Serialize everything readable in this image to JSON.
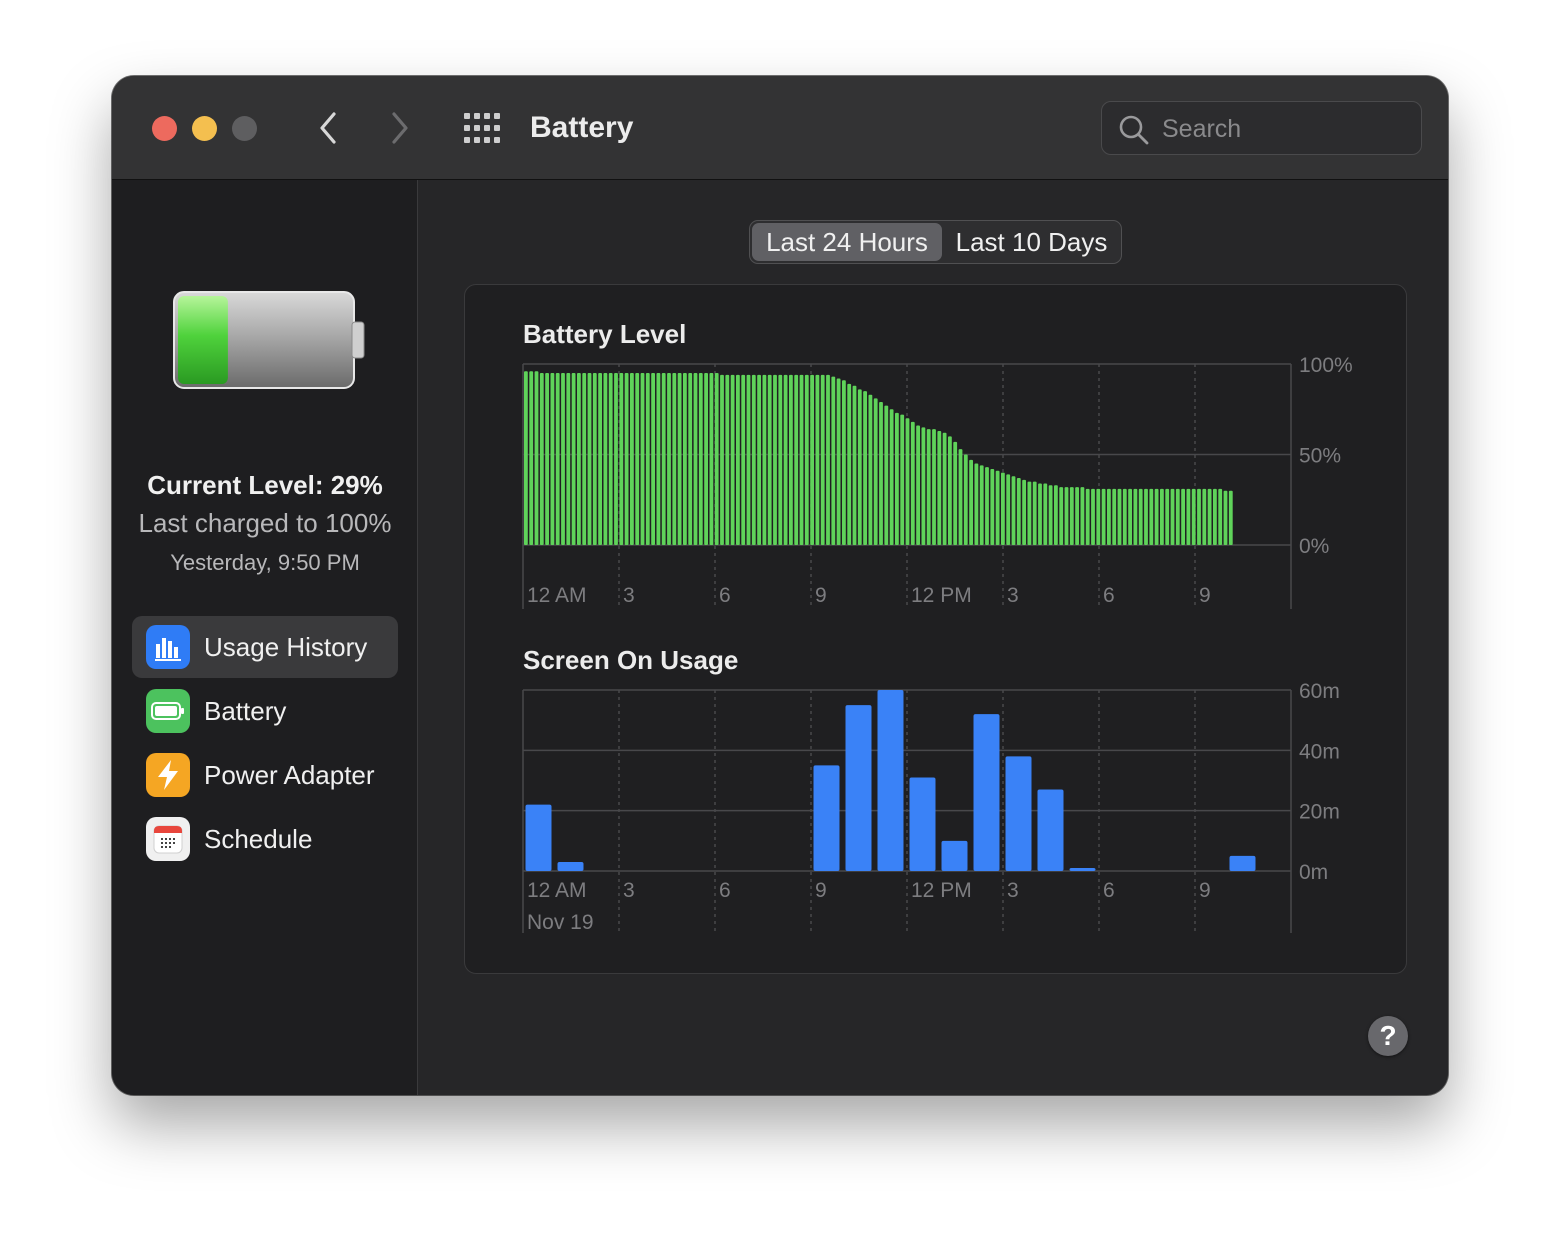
{
  "window": {
    "title": "Battery",
    "search_placeholder": "Search",
    "help_label": "?"
  },
  "sidebar": {
    "current_level": "Current Level: 29%",
    "last_charged": "Last charged to 100%",
    "last_charged_time": "Yesterday, 9:50 PM",
    "battery_icon_fill": 0.29,
    "items": [
      {
        "label": "Usage History",
        "icon": "usage-history-icon",
        "color": "#2f7cf6",
        "selected": true
      },
      {
        "label": "Battery",
        "icon": "battery-icon",
        "color": "#4cc25e",
        "selected": false
      },
      {
        "label": "Power Adapter",
        "icon": "power-adapter-icon",
        "color": "#f5a623",
        "selected": false
      },
      {
        "label": "Schedule",
        "icon": "schedule-icon",
        "color": "#f0f0f0",
        "selected": false
      }
    ]
  },
  "tabs": [
    {
      "label": "Last 24 Hours",
      "selected": true
    },
    {
      "label": "Last 10 Days",
      "selected": false
    }
  ],
  "chart_data": [
    {
      "type": "bar",
      "title": "Battery Level",
      "color": "#5fd35a",
      "x_ticks": [
        "12 AM",
        "3",
        "6",
        "9",
        "12 PM",
        "3",
        "6",
        "9"
      ],
      "y_ticks": [
        "100%",
        "50%",
        "0%"
      ],
      "ylim": [
        0,
        100
      ],
      "values": [
        96,
        96,
        96,
        95,
        95,
        95,
        95,
        95,
        95,
        95,
        95,
        95,
        95,
        95,
        95,
        95,
        95,
        95,
        95,
        95,
        95,
        95,
        95,
        95,
        95,
        95,
        95,
        95,
        95,
        95,
        95,
        95,
        95,
        95,
        95,
        95,
        95,
        94,
        94,
        94,
        94,
        94,
        94,
        94,
        94,
        94,
        94,
        94,
        94,
        94,
        94,
        94,
        94,
        94,
        94,
        94,
        94,
        94,
        93,
        92,
        91,
        89,
        88,
        86,
        85,
        83,
        81,
        79,
        77,
        75,
        73,
        72,
        70,
        68,
        66,
        65,
        64,
        64,
        63,
        62,
        60,
        57,
        53,
        50,
        47,
        45,
        44,
        43,
        42,
        41,
        40,
        39,
        38,
        37,
        36,
        35,
        35,
        34,
        34,
        33,
        33,
        32,
        32,
        32,
        32,
        32,
        31,
        31,
        31,
        31,
        31,
        31,
        31,
        31,
        31,
        31,
        31,
        31,
        31,
        31,
        31,
        31,
        31,
        31,
        31,
        31,
        31,
        31,
        31,
        31,
        31,
        31,
        30,
        30
      ],
      "grid": true
    },
    {
      "type": "bar",
      "title": "Screen On Usage",
      "color": "#3a82f7",
      "x_ticks": [
        "12 AM",
        "3",
        "6",
        "9",
        "12 PM",
        "3",
        "6",
        "9"
      ],
      "x_subtitle": "Nov 19",
      "y_ticks": [
        "60m",
        "40m",
        "20m",
        "0m"
      ],
      "ylim": [
        0,
        60
      ],
      "hour_slots": 24,
      "values": [
        22,
        3,
        0,
        0,
        0,
        0,
        0,
        0,
        0,
        35,
        55,
        60,
        31,
        10,
        52,
        38,
        27,
        1,
        0,
        0,
        0,
        0,
        5,
        0
      ],
      "grid": true
    }
  ]
}
